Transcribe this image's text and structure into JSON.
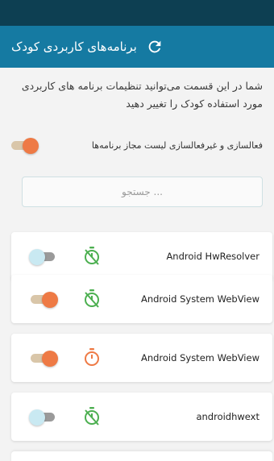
{
  "app_bar": {
    "title": "برنامه‌های کاربردی کودک"
  },
  "description": "شما در این قسمت می‌توانید تنظیمات برنامه های کاربردی مورد استفاده کودک را تغییر دهید",
  "master_toggle": {
    "label": "فعالسازی و غیرفعالسازی لیست مجاز برنامه‌ها",
    "state": "on"
  },
  "search": {
    "placeholder": "جستجو ..."
  },
  "apps": [
    {
      "name": "Android HwResolver",
      "toggle": "off",
      "timer_icon": "timer-off-icon",
      "timer_color": "#4caf50"
    },
    {
      "name": "Android System WebView",
      "toggle": "on",
      "timer_icon": "timer-off-icon",
      "timer_color": "#4caf50"
    },
    {
      "name": "Android System WebView",
      "toggle": "on",
      "timer_icon": "timer-icon",
      "timer_color": "#ee7a45"
    },
    {
      "name": "androidhwext",
      "toggle": "off",
      "timer_icon": "timer-off-icon",
      "timer_color": "#4caf50"
    }
  ],
  "colors": {
    "status_bar": "#0d3f52",
    "app_bar": "#157aa2",
    "toggle_on_thumb": "#ee7a45",
    "toggle_off_thumb": "#c9e9f2"
  }
}
